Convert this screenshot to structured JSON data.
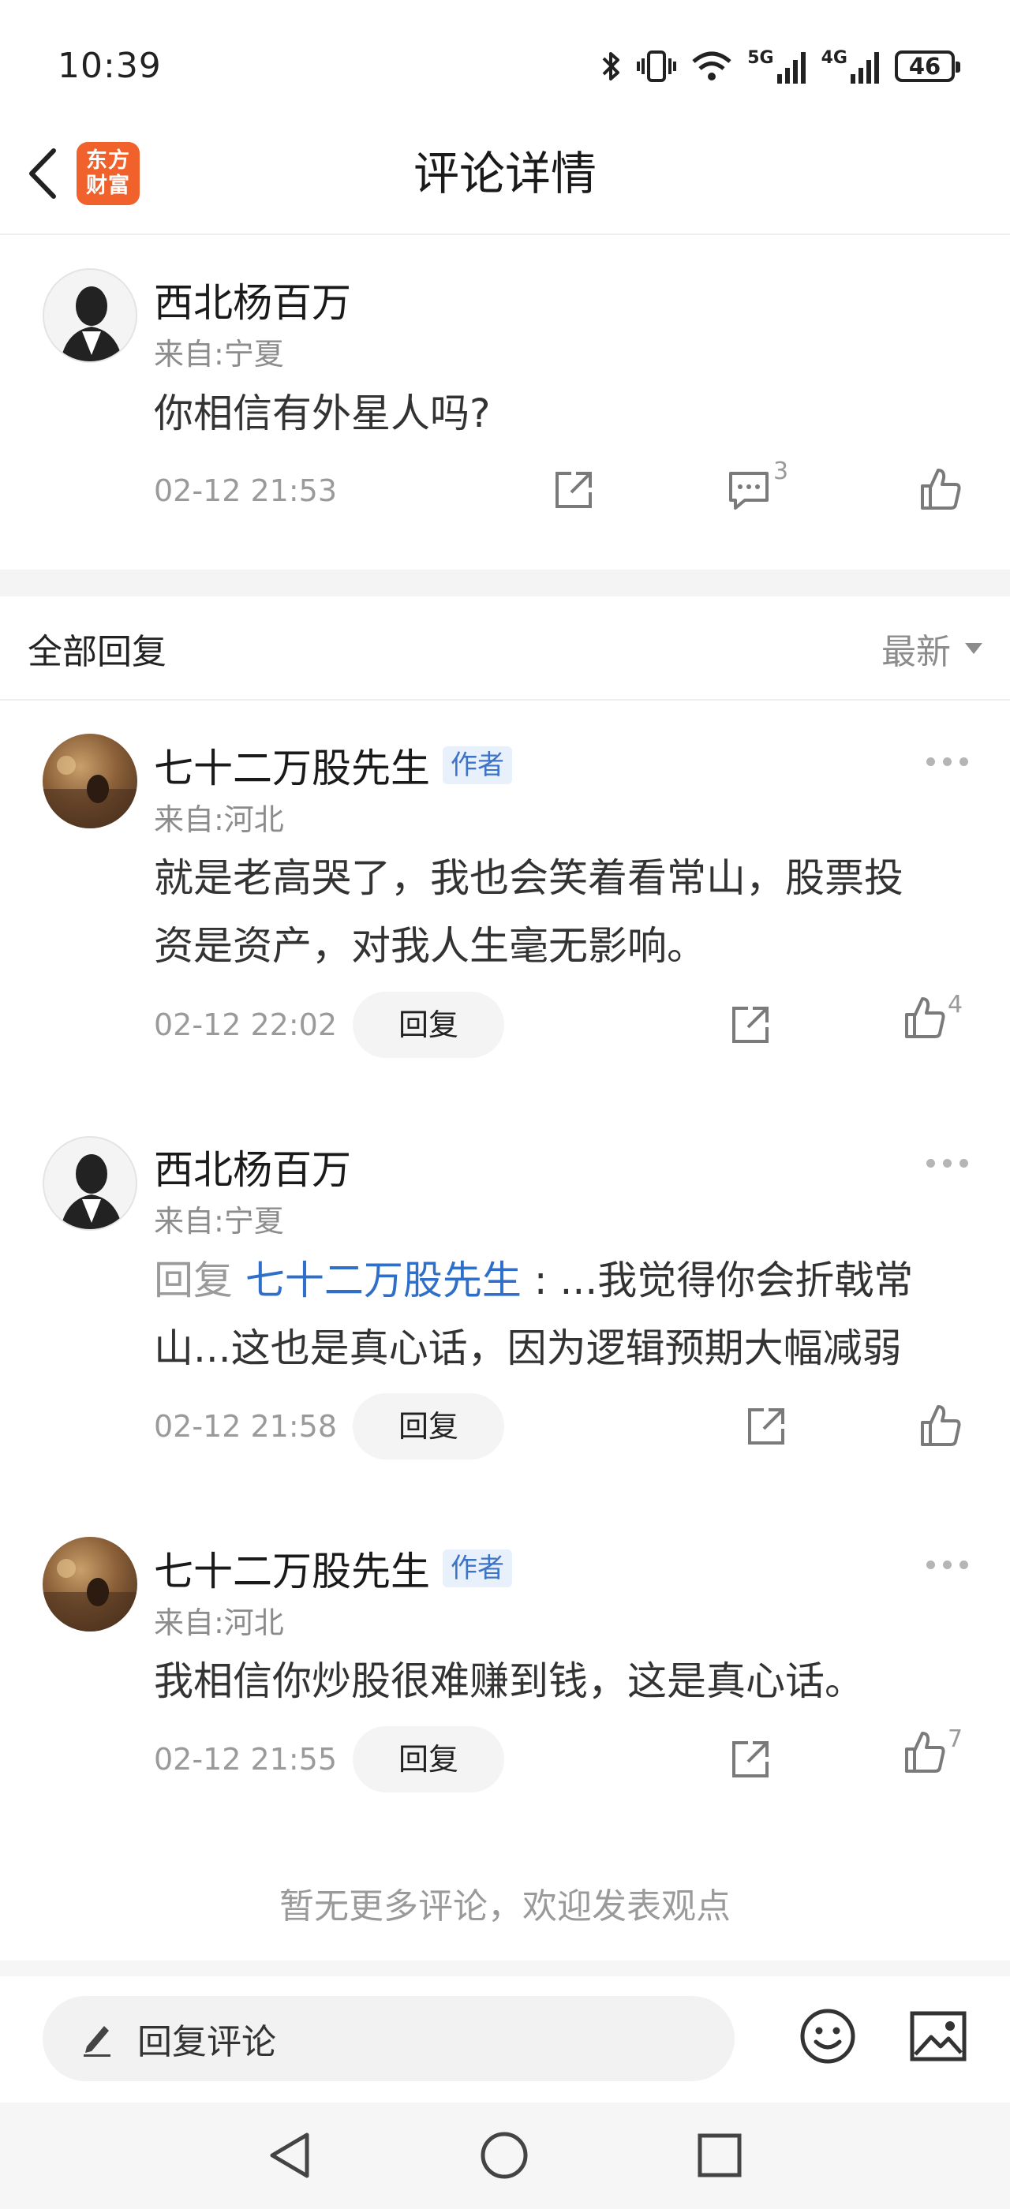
{
  "status_bar": {
    "time": "10:39",
    "network_5g": "5G",
    "network_4g": "4G",
    "battery": "46"
  },
  "header": {
    "title": "评论详情",
    "app_logo_line1": "东方",
    "app_logo_line2": "财富"
  },
  "main_comment": {
    "user": "西北杨百万",
    "location": "来自:宁夏",
    "text": "你相信有外星人吗?",
    "time": "02-12 21:53",
    "comment_count": "3"
  },
  "replies_section": {
    "title": "全部回复",
    "sort_label": "最新"
  },
  "replies": [
    {
      "user": "七十二万股先生",
      "badge": "作者",
      "location": "来自:河北",
      "text_line1": "就是老高哭了，我也会笑着看常山，股票投",
      "text_line2": "资是资产，对我人生毫无影响。",
      "time": "02-12 22:02",
      "reply_label": "回复",
      "like_count": "4"
    },
    {
      "user": "西北杨百万",
      "location": "来自:宁夏",
      "reply_prefix": "回复 ",
      "reply_to": "七十二万股先生",
      "text_line1": " : ...我觉得你会折戟常",
      "text_line2": "山...这也是真心话，因为逻辑预期大幅减弱",
      "time": "02-12 21:58",
      "reply_label": "回复"
    },
    {
      "user": "七十二万股先生",
      "badge": "作者",
      "location": "来自:河北",
      "text_line1": "我相信你炒股很难赚到钱，这是真心话。",
      "time": "02-12 21:55",
      "reply_label": "回复",
      "like_count": "7"
    }
  ],
  "footer_note": "暂无更多评论，欢迎发表观点",
  "bottom_bar": {
    "input_placeholder": "回复评论"
  },
  "colors": {
    "brand_orange": "#f0612b",
    "link_blue": "#2f6fc9",
    "badge_bg": "#e8f0fc",
    "muted_text": "#9a9a9a"
  },
  "icons": [
    "bluetooth-icon",
    "vibrate-icon",
    "wifi-icon",
    "signal-icon",
    "battery-icon",
    "back-icon",
    "share-icon",
    "comment-icon",
    "like-icon",
    "more-icon",
    "sort-arrow-icon",
    "edit-icon",
    "emoji-icon",
    "image-icon",
    "nav-back-icon",
    "nav-home-icon",
    "nav-recents-icon"
  ]
}
